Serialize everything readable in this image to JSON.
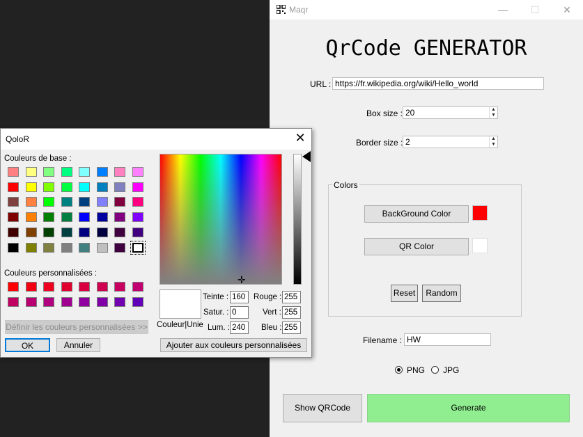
{
  "main_window": {
    "title": "Maqr",
    "controls": {
      "minimize": "—",
      "maximize": "☐",
      "close": "✕"
    },
    "app_title": "QrCode GENERATOR",
    "url": {
      "label": "URL :",
      "value": "https://fr.wikipedia.org/wiki/Hello_world"
    },
    "box_size": {
      "label": "Box size :",
      "value": "20"
    },
    "border_size": {
      "label": "Border size :",
      "value": "2"
    },
    "colors": {
      "legend": "Colors",
      "background_button": "BackGround Color",
      "background_color": "#ff0000",
      "qr_button": "QR Color",
      "qr_color": "#ffffff",
      "reset": "Reset",
      "random": "Random"
    },
    "filename": {
      "label": "Filename :",
      "value": "HW"
    },
    "format": {
      "options": [
        "PNG",
        "JPG"
      ],
      "selected": "PNG"
    },
    "show_button": "Show QRCode",
    "generate_button": "Generate",
    "generate_color": "#90ee90"
  },
  "dialog": {
    "title": "QoloR",
    "basic_colors_label": "Couleurs de base :",
    "basic_colors": [
      [
        "#ff8080",
        "#ffff80",
        "#80ff80",
        "#00ff80",
        "#80ffff",
        "#0080ff",
        "#ff80c0",
        "#ff80ff"
      ],
      [
        "#ff0000",
        "#ffff00",
        "#80ff00",
        "#00ff40",
        "#00ffff",
        "#0080c0",
        "#8080c0",
        "#ff00ff"
      ],
      [
        "#804040",
        "#ff8040",
        "#00ff00",
        "#008080",
        "#004080",
        "#8080ff",
        "#800040",
        "#ff0080"
      ],
      [
        "#800000",
        "#ff8000",
        "#008000",
        "#008040",
        "#0000ff",
        "#0000a0",
        "#800080",
        "#8000ff"
      ],
      [
        "#400000",
        "#804000",
        "#004000",
        "#004040",
        "#000080",
        "#000040",
        "#400040",
        "#400080"
      ],
      [
        "#000000",
        "#808000",
        "#808040",
        "#808080",
        "#408080",
        "#c0c0c0",
        "#400040",
        "#ffffff"
      ]
    ],
    "custom_colors_label": "Couleurs personnalisées :",
    "custom_colors": [
      [
        "#ff0000",
        "#f00010",
        "#ee0020",
        "#e00030",
        "#d80040",
        "#d00050",
        "#c80060",
        "#c00070"
      ],
      [
        "#c00060",
        "#b80070",
        "#b00080",
        "#a00090",
        "#9000a0",
        "#8000a8",
        "#7000b0",
        "#6000b8"
      ]
    ],
    "define_custom": "Définir les couleurs personnalisées >>",
    "ok": "OK",
    "cancel": "Annuler",
    "solid_color_label": "Couleur|Unie",
    "hue": {
      "label": "Teinte :",
      "value": "160"
    },
    "sat": {
      "label": "Satur. :",
      "value": "0"
    },
    "lum": {
      "label": "Lum. :",
      "value": "240"
    },
    "red": {
      "label": "Rouge :",
      "value": "255"
    },
    "green": {
      "label": "Vert :",
      "value": "255"
    },
    "blue": {
      "label": "Bleu :",
      "value": "255"
    },
    "add_custom": "Ajouter aux couleurs personnalisées"
  }
}
